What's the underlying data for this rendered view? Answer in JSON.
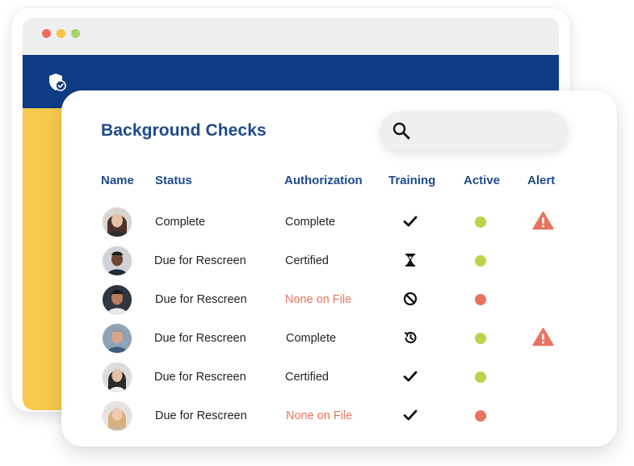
{
  "browser": {
    "dots": [
      "#ee6b5c",
      "#f6c344",
      "#a8d26c"
    ],
    "header_color": "#0e3c85",
    "logo_icon": "shield-check-icon"
  },
  "card": {
    "title": "Background Checks",
    "search": {
      "placeholder": "",
      "icon": "search-icon"
    },
    "columns": [
      "Name",
      "Status",
      "Authorization",
      "Training",
      "Active",
      "Alert"
    ],
    "rows": [
      {
        "status": "Complete",
        "authorization": "Complete",
        "auth_highlight": false,
        "training": "check-icon",
        "active": "green",
        "alert": true
      },
      {
        "status": "Due for Rescreen",
        "authorization": "Certified",
        "auth_highlight": false,
        "training": "hourglass-icon",
        "active": "green",
        "alert": false
      },
      {
        "status": "Due for Rescreen",
        "authorization": "None on File",
        "auth_highlight": true,
        "training": "prohibited-icon",
        "active": "red",
        "alert": false
      },
      {
        "status": "Due for Rescreen",
        "authorization": "Complete",
        "auth_highlight": false,
        "training": "history-icon",
        "active": "green",
        "alert": true
      },
      {
        "status": "Due for Rescreen",
        "authorization": "Certified",
        "auth_highlight": false,
        "training": "check-icon",
        "active": "green",
        "alert": false
      },
      {
        "status": "Due for Rescreen",
        "authorization": "None on File",
        "auth_highlight": true,
        "training": "check-icon",
        "active": "red",
        "alert": false
      }
    ]
  },
  "colors": {
    "title": "#1e4a8c",
    "green": "#b8d44a",
    "red": "#e8735f",
    "alert": "#e8735f",
    "yellow_panel": "#f8c94c"
  }
}
